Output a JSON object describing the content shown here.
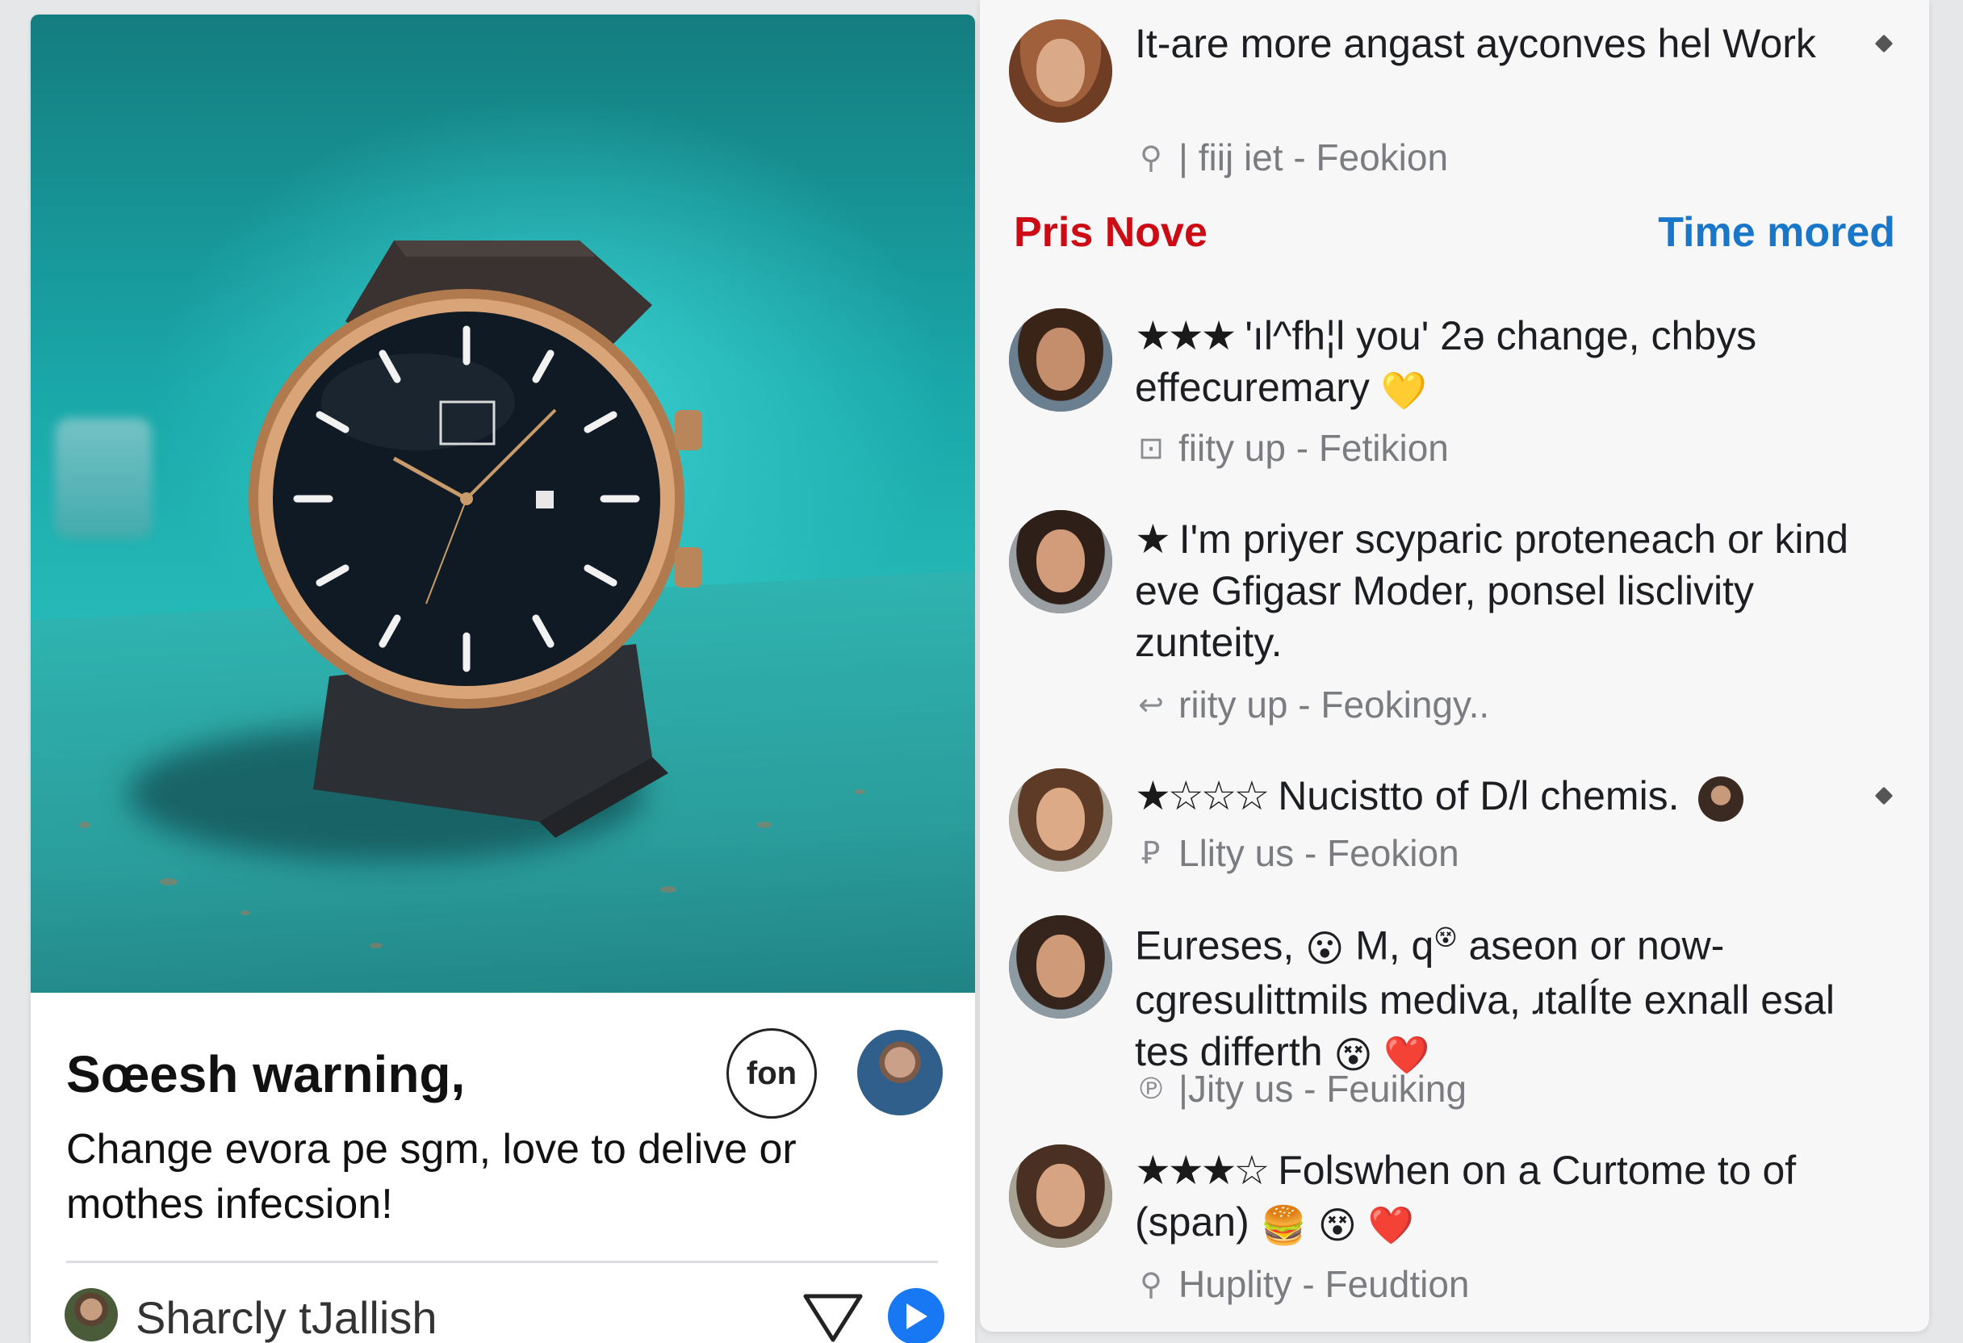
{
  "post": {
    "title": "Sœesh warning,",
    "badge_label": "fon",
    "text": "Change evora pe sgm, love to delive or mothes infecsion!",
    "author_name": "Sharcly tJallish",
    "image_subject": "wristwatch on teal surface",
    "colors": {
      "accent": "#1877f2",
      "photo_bg": "#1aa7a8"
    }
  },
  "feed": {
    "top_item": {
      "text": "It-are more angast ayconves hel Work",
      "meta": "| fiij iet - Feokion",
      "meta_icon": "search-icon"
    },
    "tabs": {
      "left": "Pris Nove",
      "right": "Time mored"
    },
    "tab_colors": {
      "left": "#cc0b14",
      "right": "#1877c9"
    },
    "items": [
      {
        "stars": "★★★",
        "text": "'ıl^fh¦l you' 2ə change, chbys effecuremary",
        "emoji": "💛",
        "meta": "fiity up - Fetikion",
        "meta_icon": "box-icon"
      },
      {
        "stars": "★",
        "text": "I'm priyer scyparic proteneach or kind eve Gfigasr Moder, ponsel lisclivity zunteity.",
        "meta": "riity up - Feokingy..",
        "meta_icon": "reply-icon"
      },
      {
        "stars": "★☆☆☆",
        "text": "Nucistto of D/l chemis.",
        "meta": "Llity us - Feokion",
        "meta_icon": "p-icon"
      },
      {
        "text_a": "Eureses,",
        "emoji_a": "😮",
        "text_b": "M, q",
        "emoji_b": "😵",
        "text_c": "aseon or now-cgresulittmils mediva, ɹtalÍte exnall esal tes differth",
        "emoji_c": "😵",
        "emoji_d": "❤️",
        "meta": "|Jity us - Feuiking",
        "meta_icon": "p-icon"
      },
      {
        "stars": "★★★☆",
        "text": "Folswhen on a Curtome to of (span)",
        "emojis": [
          "🍔",
          "😵",
          "❤️"
        ],
        "meta": "Huplity - Feudtion",
        "meta_icon": "pin-icon"
      }
    ]
  }
}
